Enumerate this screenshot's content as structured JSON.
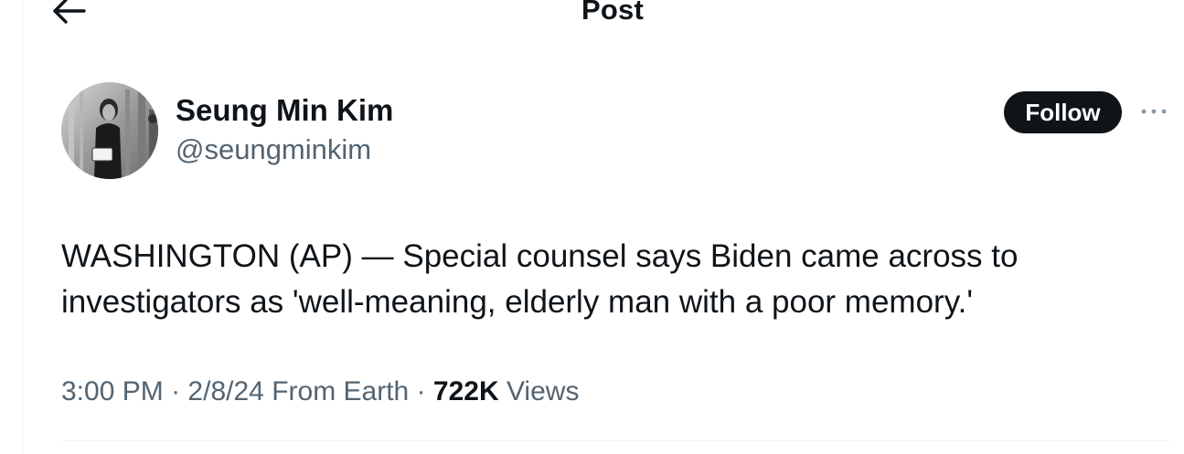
{
  "header": {
    "title": "Post",
    "back_icon": "arrow-left-icon"
  },
  "author": {
    "display_name": "Seung Min Kim",
    "handle": "@seungminkim",
    "avatar_icon": "profile-photo"
  },
  "actions": {
    "follow_label": "Follow",
    "more_icon": "more-horizontal-icon"
  },
  "tweet": {
    "text": "WASHINGTON (AP) — Special counsel says Biden came across to investigators as 'well-meaning, elderly man with a poor memory.'"
  },
  "meta": {
    "time": "3:00 PM",
    "separator": "·",
    "date": "2/8/24",
    "location": "From Earth",
    "views_count": "722K",
    "views_label": "Views"
  },
  "colors": {
    "text_primary": "#0f1419",
    "text_secondary": "#536471",
    "follow_bg": "#0f1419",
    "border": "#eff3f4"
  }
}
